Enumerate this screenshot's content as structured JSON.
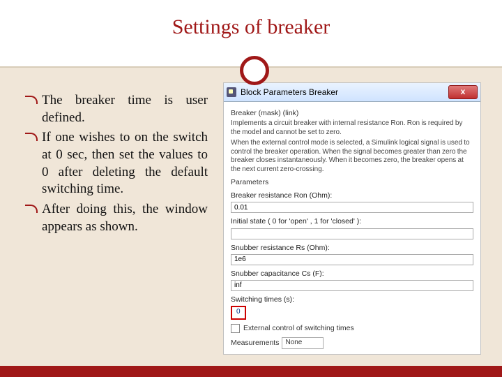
{
  "slide": {
    "title": "Settings of breaker",
    "bullets": [
      "The breaker time is user defined.",
      "If one wishes to on the switch at 0 sec, then set the values to 0 after deleting the default switching time.",
      "After doing this, the window appears as shown."
    ]
  },
  "dialog": {
    "title": "Block Parameters Breaker",
    "close_label": "x",
    "heading": "Breaker (mask) (link)",
    "description1": "Implements a circuit breaker with internal resistance Ron. Ron is required by the model and cannot be set to zero.",
    "description2": "When the external control mode is selected, a Simulink logical signal is used to control the breaker operation. When the signal becomes greater than zero the breaker closes instantaneously. When it becomes zero, the breaker opens at the next current zero-crossing.",
    "param_header": "Parameters",
    "fields": {
      "ron": {
        "label": "Breaker resistance Ron (Ohm):",
        "value": "0.01"
      },
      "initial": {
        "label": "Initial state ( 0 for 'open' , 1 for 'closed' ):",
        "value": ""
      },
      "rs": {
        "label": "Snubber resistance Rs (Ohm):",
        "value": "1e6"
      },
      "cs": {
        "label": "Snubber capacitance Cs (F):",
        "value": "inf"
      },
      "switching": {
        "label": "Switching times (s):",
        "value": "0"
      }
    },
    "external_control": "External control of switching times",
    "measurements": {
      "label": "Measurements",
      "value": "None"
    }
  }
}
